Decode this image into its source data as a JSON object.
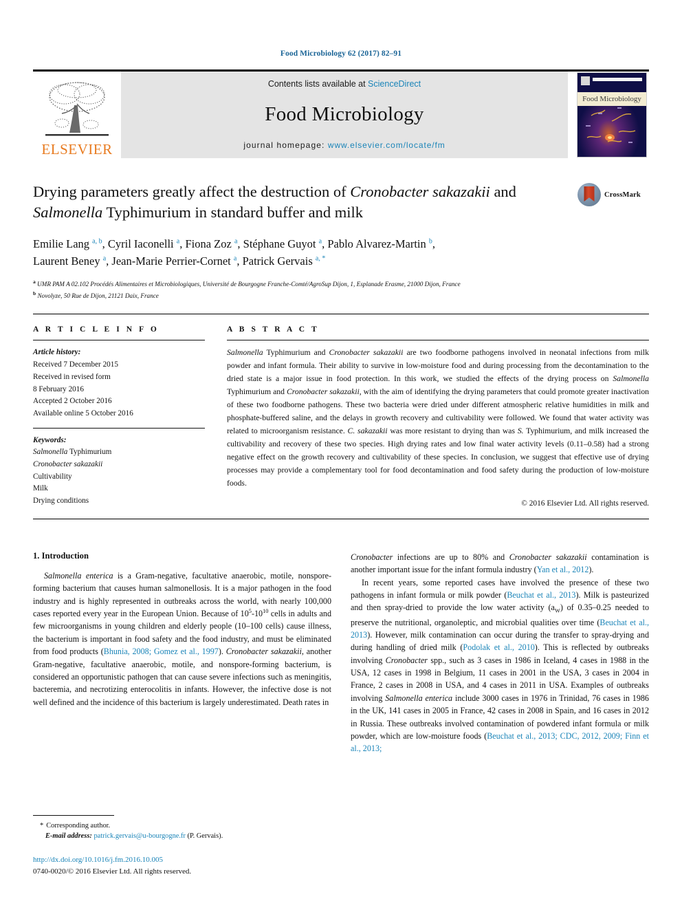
{
  "running_head": "Food Microbiology 62 (2017) 82–91",
  "masthead": {
    "publisher_name": "ELSEVIER",
    "contents_prefix": "Contents lists available at ",
    "contents_link": "ScienceDirect",
    "journal_name": "Food Microbiology",
    "homepage_prefix": "journal homepage: ",
    "homepage_url": "www.elsevier.com/locate/fm",
    "cover_title": "Food Microbiology"
  },
  "crossmark": {
    "label": "CrossMark"
  },
  "article": {
    "title_part1": "Drying parameters greatly affect the destruction of ",
    "title_italic1": "Cronobacter sakazakii",
    "title_part2": " and ",
    "title_italic2": "Salmonella",
    "title_part3": " Typhimurium in standard buffer and milk",
    "authors_line1": "Emilie Lang <sup>a, b</sup>, Cyril Iaconelli <sup>a</sup>, Fiona Zoz <sup>a</sup>, Stéphane Guyot <sup>a</sup>, Pablo Alvarez-Martin <sup>b</sup>,",
    "authors_line2": "Laurent Beney <sup>a</sup>, Jean-Marie Perrier-Cornet <sup>a</sup>, Patrick Gervais <sup>a, *</sup>",
    "affiliation_a": "<sup>a</sup> UMR PAM A 02.102 Procédés Alimentaires et Microbiologiques, Université de Bourgogne Franche-Comté/AgroSup Dijon, 1, Esplanade Erasme, 21000 Dijon, France",
    "affiliation_b": "<sup>b</sup> Novolyze, 50 Rue de Dijon, 21121 Daix, France"
  },
  "article_info": {
    "heading": "A R T I C L E  I N F O",
    "history_label": "Article history:",
    "history": [
      "Received 7 December 2015",
      "Received in revised form",
      "8 February 2016",
      "Accepted 2 October 2016",
      "Available online 5 October 2016"
    ],
    "keywords_label": "Keywords:",
    "keywords": [
      "Salmonella Typhimurium",
      "Cronobacter sakazakii",
      "Cultivability",
      "Milk",
      "Drying conditions"
    ]
  },
  "abstract": {
    "heading": "A B S T R A C T",
    "text": "<i>Salmonella</i> Typhimurium and <i>Cronobacter sakazakii</i> are two foodborne pathogens involved in neonatal infections from milk powder and infant formula. Their ability to survive in low-moisture food and during processing from the decontamination to the dried state is a major issue in food protection. In this work, we studied the effects of the drying process on <i>Salmonella</i> Typhimurium and <i>Cronobacter sakazakii</i>, with the aim of identifying the drying parameters that could promote greater inactivation of these two foodborne pathogens. These two bacteria were dried under different atmospheric relative humidities in milk and phosphate-buffered saline, and the delays in growth recovery and cultivability were followed. We found that water activity was related to microorganism resistance. <i>C. sakazakii</i> was more resistant to drying than was <i>S.</i> Typhimurium, and milk increased the cultivability and recovery of these two species. High drying rates and low final water activity levels (0.11–0.58) had a strong negative effect on the growth recovery and cultivability of these species. In conclusion, we suggest that effective use of drying processes may provide a complementary tool for food decontamination and food safety during the production of low-moisture foods.",
    "copyright": "© 2016 Elsevier Ltd. All rights reserved."
  },
  "introduction": {
    "heading": "1.  Introduction",
    "left_para1": "<i>Salmonella enterica</i> is a Gram-negative, facultative anaerobic, motile, nonspore-forming bacterium that causes human salmonellosis. It is a major pathogen in the food industry and is highly represented in outbreaks across the world, with nearly 100,000 cases reported every year in the European Union. Because of 10<sup>5</sup>-10<sup>10</sup> cells in adults and few microorganisms in young children and elderly people (10–100 cells) cause illness, the bacterium is important in food safety and the food industry, and must be eliminated from food products (<span class=\"cite\">Bhunia, 2008; Gomez et al., 1997</span>). <i>Cronobacter sakazakii</i>, another Gram-negative, facultative anaerobic, motile, and nonspore-forming bacterium, is considered an opportunistic pathogen that can cause severe infections such as meningitis, bacteremia, and necrotizing enterocolitis in infants. However, the infective dose is not well defined and the incidence of this bacterium is largely underestimated. Death rates in",
    "right_para1": "<i>Cronobacter</i> infections are up to 80% and <i>Cronobacter sakazakii</i> contamination is another important issue for the infant formula industry (<span class=\"cite\">Yan et al., 2012</span>).",
    "right_para2": "In recent years, some reported cases have involved the presence of these two pathogens in infant formula or milk powder (<span class=\"cite\">Beuchat et al., 2013</span>). Milk is pasteurized and then spray-dried to provide the low water activity (a<sub>W</sub>) of 0.35–0.25 needed to preserve the nutritional, organoleptic, and microbial qualities over time (<span class=\"cite\">Beuchat et al., 2013</span>). However, milk contamination can occur during the transfer to spray-drying and during handling of dried milk (<span class=\"cite\">Podolak et al., 2010</span>). This is reflected by outbreaks involving <i>Cronobacter</i> spp., such as 3 cases in 1986 in Iceland, 4 cases in 1988 in the USA, 12 cases in 1998 in Belgium, 11 cases in 2001 in the USA, 3 cases in 2004 in France, 2 cases in 2008 in USA, and 4 cases in 2011 in USA. Examples of outbreaks involving <i>Salmonella enterica</i> include 3000 cases in 1976 in Trinidad, 76 cases in 1986 in the UK, 141 cases in 2005 in France, 42 cases in 2008 in Spain, and 16 cases in 2012 in Russia. These outbreaks involved contamination of powdered infant formula or milk powder, which are low-moisture foods (<span class=\"cite\">Beuchat et al., 2013; CDC, 2012, 2009; Finn et al., 2013;</span>"
  },
  "footer": {
    "corresponding_star": "*",
    "corresponding_label": "Corresponding author.",
    "email_label": "E-mail address:",
    "email": "patrick.gervais@u-bourgogne.fr",
    "email_suffix": "(P. Gervais).",
    "doi": "http://dx.doi.org/10.1016/j.fm.2016.10.005",
    "issn": "0740-0020/© 2016 Elsevier Ltd. All rights reserved."
  }
}
